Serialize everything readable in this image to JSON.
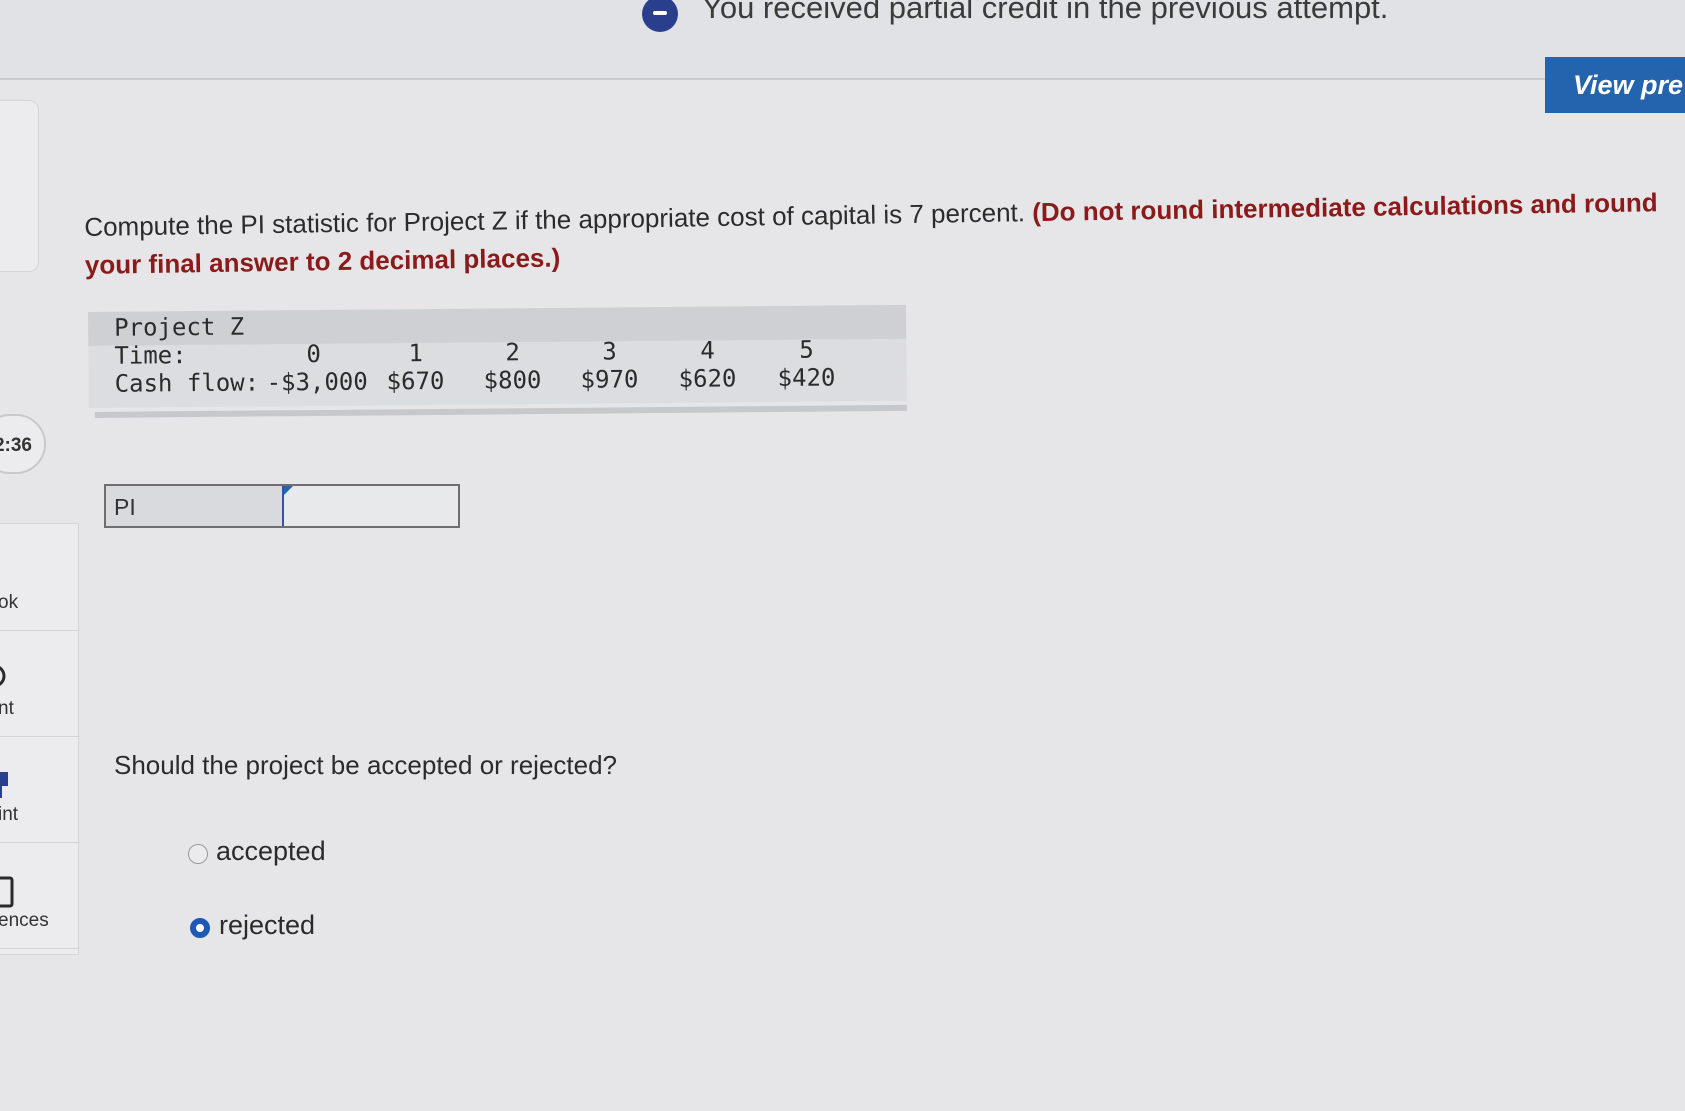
{
  "banner": {
    "icon": "minus-circle-icon",
    "text": "You received partial credit in the previous attempt."
  },
  "header": {
    "view_button_label": "View pre"
  },
  "sidebar": {
    "timer": "2:36",
    "items": [
      {
        "label": "ok",
        "icon": "book-icon"
      },
      {
        "label": "nt",
        "icon": "print-icon"
      },
      {
        "label": "int",
        "icon": "hint-icon"
      },
      {
        "label": "ences",
        "icon": "references-icon"
      }
    ]
  },
  "question": {
    "text": "Compute the PI statistic for Project Z if the appropriate cost of capital is 7 percent. ",
    "instruction": "(Do not round intermediate calculations and round your final answer to 2 decimal places.)"
  },
  "project_table": {
    "title": "Project Z",
    "time_label": "Time:",
    "cash_label": "Cash flow:",
    "times": [
      "0",
      "1",
      "2",
      "3",
      "4",
      "5"
    ],
    "cash_flows": [
      "-$3,000",
      "$670",
      "$800",
      "$970",
      "$620",
      "$420"
    ]
  },
  "answer": {
    "label": "PI",
    "value": ""
  },
  "decision": {
    "question": "Should the project be accepted or rejected?",
    "options": [
      {
        "label": "accepted",
        "selected": false
      },
      {
        "label": "rejected",
        "selected": true
      }
    ]
  },
  "colors": {
    "accent": "#2463ad",
    "emphasis": "#8b1a1a",
    "background": "#e6e6e8"
  }
}
